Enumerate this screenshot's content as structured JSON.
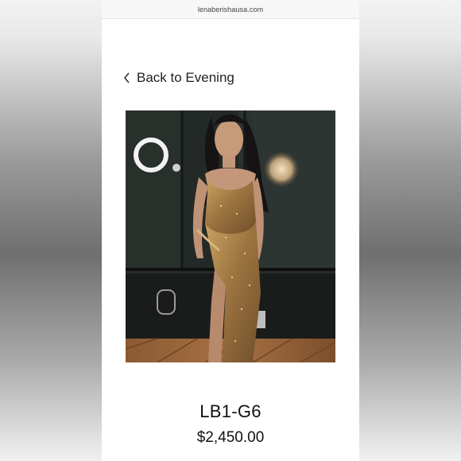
{
  "browser": {
    "url": "lenaberishausa.com"
  },
  "nav": {
    "back_label": "Back to Evening",
    "back_icon": "chevron-left-icon"
  },
  "product": {
    "image_subject": "evening-gown-photo",
    "title": "LB1-G6",
    "price": "$2,450.00"
  },
  "colors": {
    "page_background": "#ffffff",
    "text": "#111111",
    "gown_gold": "#a8834a"
  }
}
